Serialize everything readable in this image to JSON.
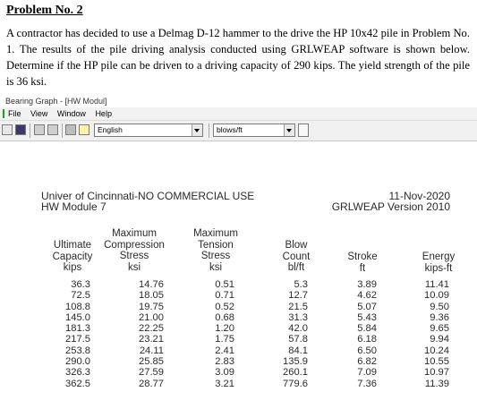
{
  "document": {
    "title": "Problem No. 2",
    "paragraph": "A contractor has decided to use a Delmag D-12 hammer to the drive the HP 10x42 pile in Problem No. 1. The results of the pile driving analysis conducted using GRLWEAP software is shown below. Determine if the HP pile can be driven to a driving capacity of 290 kips. The yield strength of the pile is 36 ksi."
  },
  "window": {
    "title": "Bearing Graph - [HW Modul]",
    "menu": [
      "File",
      "View",
      "Window",
      "Help"
    ],
    "toolbar": {
      "icons": [
        "new-icon",
        "save-icon",
        "copy-icon",
        "paste-icon",
        "print-icon",
        "help-icon"
      ],
      "unit_system": "English",
      "blow_unit": "blows/ft"
    }
  },
  "report": {
    "org": "Univer of Cincinnati-NO COMMERCIAL USE",
    "module": "HW Module 7",
    "date": "11-Nov-2020",
    "software": "GRLWEAP Version 2010",
    "columns": [
      {
        "lines": [
          "Ultimate",
          "Capacity",
          "kips"
        ]
      },
      {
        "lines": [
          "Maximum",
          "Compression",
          "Stress",
          "ksi"
        ]
      },
      {
        "lines": [
          "Maximum",
          "Tension",
          "Stress",
          "ksi"
        ]
      },
      {
        "lines": [
          "Blow",
          "Count",
          "bl/ft"
        ]
      },
      {
        "lines": [
          "Stroke",
          "ft"
        ]
      },
      {
        "lines": [
          "Energy",
          "kips-ft"
        ]
      }
    ],
    "rows": [
      [
        "36.3",
        "14.76",
        "0.51",
        "5.3",
        "3.89",
        "11.41"
      ],
      [
        "72.5",
        "18.05",
        "0.71",
        "12.7",
        "4.62",
        "10.09"
      ],
      [
        "108.8",
        "19.75",
        "0.52",
        "21.5",
        "5.07",
        "9.50"
      ],
      [
        "145.0",
        "21.00",
        "0.68",
        "31.3",
        "5.43",
        "9.36"
      ],
      [
        "181.3",
        "22.25",
        "1.20",
        "42.0",
        "5.84",
        "9.65"
      ],
      [
        "217.5",
        "23.21",
        "1.75",
        "57.8",
        "6.18",
        "9.94"
      ],
      [
        "253.8",
        "24.11",
        "2.41",
        "84.1",
        "6.50",
        "10.24"
      ],
      [
        "290.0",
        "25.85",
        "2.83",
        "135.9",
        "6.82",
        "10.55"
      ],
      [
        "326.3",
        "27.59",
        "3.09",
        "260.1",
        "7.09",
        "10.97"
      ],
      [
        "362.5",
        "28.77",
        "3.21",
        "779.6",
        "7.36",
        "11.39"
      ]
    ]
  }
}
